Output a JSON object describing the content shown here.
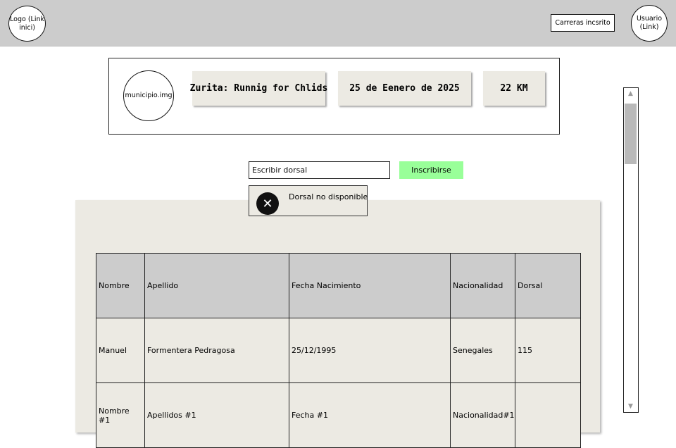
{
  "header": {
    "logo_label": "Logo (Link inici)",
    "races_button": "Carreras incsrito",
    "user_label": "Usuario (Link)"
  },
  "event": {
    "image_label": "municipio.img",
    "title": "Zurita: Runnig for Chlids",
    "date": "25 de Eenero de 2025",
    "distance": "22 KM"
  },
  "enroll": {
    "input_value": "Escribir dorsal",
    "button_label": "Inscribirse"
  },
  "alert": {
    "icon": "close-icon",
    "message": "Dorsal no disponible"
  },
  "table": {
    "columns": [
      "Nombre",
      "Apellido",
      "Fecha Nacimiento",
      "Nacionalidad",
      "Dorsal"
    ],
    "rows": [
      [
        "Manuel",
        "Formentera Pedragosa",
        "25/12/1995",
        "Senegales",
        "115"
      ],
      [
        "Nombre #1",
        "Apellidos #1",
        "Fecha #1",
        "Nacionalidad#1",
        ""
      ]
    ]
  },
  "colors": {
    "header_bg": "#cccccc",
    "enroll_button": "#99ff99",
    "panel_bg": "#eceae3"
  }
}
